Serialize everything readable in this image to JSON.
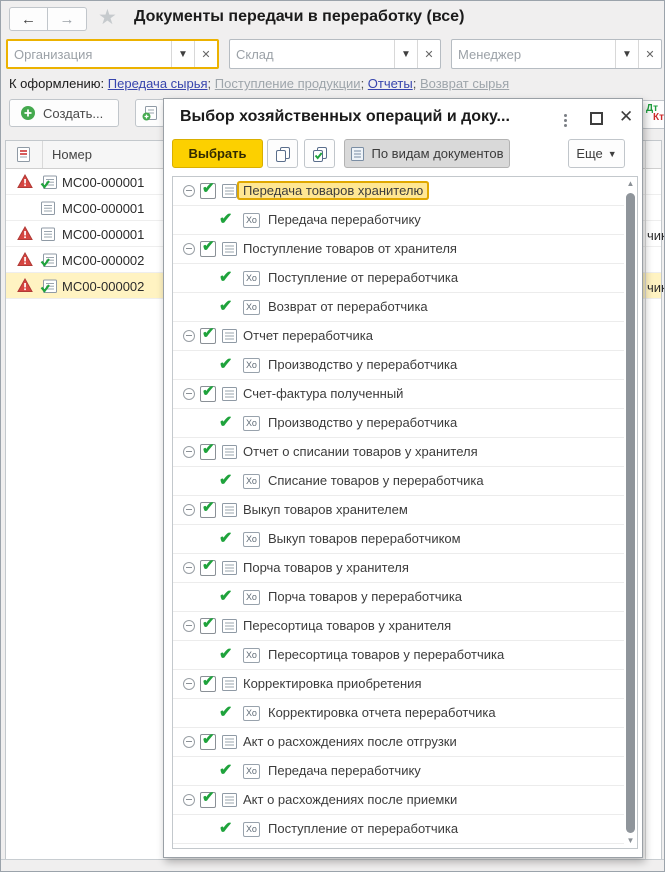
{
  "window": {
    "title": "Документы передачи в переработку (все)",
    "back_arrow": "←",
    "forward_arrow": "→"
  },
  "filters": [
    {
      "placeholder": "Организация",
      "focused": true
    },
    {
      "placeholder": "Склад",
      "focused": false
    },
    {
      "placeholder": "Менеджер",
      "focused": false
    }
  ],
  "links_row": {
    "label": "К оформлению:",
    "links": [
      {
        "text": "Передача сырья",
        "enabled": true
      },
      {
        "text": "Поступление продукции",
        "enabled": false
      },
      {
        "text": "Отчеты",
        "enabled": true
      },
      {
        "text": "Возврат сырья",
        "enabled": false
      }
    ],
    "separator": ";"
  },
  "toolbar": {
    "create_label": "Создать...",
    "dt_label": "Дт",
    "kt_label": "Кт"
  },
  "table": {
    "number_column": "Номер",
    "rows": [
      {
        "number": "МС00-000001",
        "warning": true,
        "posted": true,
        "selected": false,
        "right_text": ""
      },
      {
        "number": "МС00-000001",
        "warning": false,
        "posted": false,
        "selected": false,
        "right_text": ""
      },
      {
        "number": "МС00-000001",
        "warning": true,
        "posted": false,
        "selected": false,
        "right_text": "чик"
      },
      {
        "number": "МС00-000002",
        "warning": true,
        "posted": true,
        "selected": false,
        "right_text": ""
      },
      {
        "number": "МС00-000002",
        "warning": true,
        "posted": true,
        "selected": true,
        "right_text": "чик"
      }
    ]
  },
  "dialog": {
    "title": "Выбор хозяйственных операций и доку...",
    "select_button": "Выбрать",
    "by_types_button": "По видам документов",
    "more_button": "Еще",
    "xo_icon_label": "Хо",
    "tree": [
      {
        "type": "group",
        "label": "Передача товаров хранителю",
        "selected": true
      },
      {
        "type": "item",
        "label": "Передача переработчику"
      },
      {
        "type": "group",
        "label": "Поступление товаров от хранителя"
      },
      {
        "type": "item",
        "label": "Поступление от переработчика"
      },
      {
        "type": "item",
        "label": "Возврат от переработчика"
      },
      {
        "type": "group",
        "label": "Отчет переработчика"
      },
      {
        "type": "item",
        "label": "Производство у переработчика"
      },
      {
        "type": "group",
        "label": "Счет-фактура полученный"
      },
      {
        "type": "item",
        "label": "Производство у переработчика"
      },
      {
        "type": "group",
        "label": "Отчет о списании товаров у хранителя"
      },
      {
        "type": "item",
        "label": "Списание товаров у переработчика"
      },
      {
        "type": "group",
        "label": "Выкуп товаров хранителем"
      },
      {
        "type": "item",
        "label": "Выкуп товаров переработчиком"
      },
      {
        "type": "group",
        "label": "Порча товаров у хранителя"
      },
      {
        "type": "item",
        "label": "Порча товаров у переработчика"
      },
      {
        "type": "group",
        "label": "Пересортица товаров у хранителя"
      },
      {
        "type": "item",
        "label": "Пересортица товаров у переработчика"
      },
      {
        "type": "group",
        "label": "Корректировка приобретения"
      },
      {
        "type": "item",
        "label": "Корректировка отчета переработчика"
      },
      {
        "type": "group",
        "label": "Акт о расхождениях после отгрузки"
      },
      {
        "type": "item",
        "label": "Передача переработчику"
      },
      {
        "type": "group",
        "label": "Акт о расхождениях после приемки"
      },
      {
        "type": "item",
        "label": "Поступление от переработчика"
      },
      {
        "type": "item",
        "label": ""
      }
    ]
  },
  "colors": {
    "accent_yellow": "#fcd000",
    "focus_border": "#ecb200",
    "selection_row": "#fff3c2",
    "tree_highlight": "#ffe793",
    "tree_highlight_border": "#e0a800",
    "check_green": "#1fa33c",
    "warning_red": "#d64541",
    "link_blue": "#3745ad",
    "link_disabled": "#9ea5ab"
  }
}
